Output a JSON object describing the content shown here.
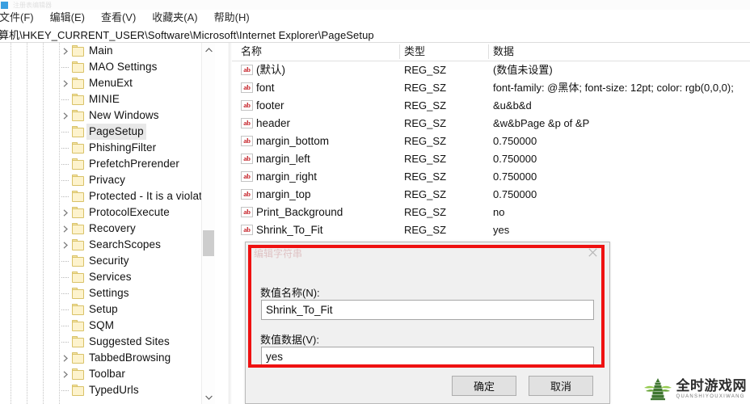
{
  "window": {
    "titlebar_text": "注册表编辑器",
    "titlebar_icon": "registry-editor-icon"
  },
  "menubar": {
    "items": [
      {
        "label": "文件(F)"
      },
      {
        "label": "编辑(E)"
      },
      {
        "label": "查看(V)"
      },
      {
        "label": "收藏夹(A)"
      },
      {
        "label": "帮助(H)"
      }
    ]
  },
  "address": {
    "path": "算机\\HKEY_CURRENT_USER\\Software\\Microsoft\\Internet Explorer\\PageSetup"
  },
  "tree": {
    "items": [
      {
        "label": "Main",
        "expandable": true,
        "selected": false
      },
      {
        "label": "MAO Settings",
        "expandable": false,
        "selected": false
      },
      {
        "label": "MenuExt",
        "expandable": true,
        "selected": false
      },
      {
        "label": "MINIE",
        "expandable": false,
        "selected": false
      },
      {
        "label": "New Windows",
        "expandable": true,
        "selected": false
      },
      {
        "label": "PageSetup",
        "expandable": false,
        "selected": true
      },
      {
        "label": "PhishingFilter",
        "expandable": false,
        "selected": false
      },
      {
        "label": "PrefetchPrerender",
        "expandable": false,
        "selected": false
      },
      {
        "label": "Privacy",
        "expandable": false,
        "selected": false
      },
      {
        "label": "Protected - It is a violation of",
        "expandable": false,
        "selected": false
      },
      {
        "label": "ProtocolExecute",
        "expandable": true,
        "selected": false
      },
      {
        "label": "Recovery",
        "expandable": true,
        "selected": false
      },
      {
        "label": "SearchScopes",
        "expandable": true,
        "selected": false
      },
      {
        "label": "Security",
        "expandable": false,
        "selected": false
      },
      {
        "label": "Services",
        "expandable": false,
        "selected": false
      },
      {
        "label": "Settings",
        "expandable": false,
        "selected": false
      },
      {
        "label": "Setup",
        "expandable": false,
        "selected": false
      },
      {
        "label": "SQM",
        "expandable": false,
        "selected": false
      },
      {
        "label": "Suggested Sites",
        "expandable": false,
        "selected": false
      },
      {
        "label": "TabbedBrowsing",
        "expandable": true,
        "selected": false
      },
      {
        "label": "Toolbar",
        "expandable": true,
        "selected": false
      },
      {
        "label": "TypedUrls",
        "expandable": false,
        "selected": false
      }
    ],
    "scrollbar": {
      "up_icon": "chevron-up-icon",
      "down_icon": "chevron-down-icon"
    }
  },
  "value_list": {
    "columns": [
      {
        "label": "名称"
      },
      {
        "label": "类型"
      },
      {
        "label": "数据"
      }
    ],
    "rows": [
      {
        "icon": "string-value-icon",
        "name": "(默认)",
        "type": "REG_SZ",
        "data": "(数值未设置)"
      },
      {
        "icon": "string-value-icon",
        "name": "font",
        "type": "REG_SZ",
        "data": "font-family: @黑体; font-size: 12pt; color: rgb(0,0,0);"
      },
      {
        "icon": "string-value-icon",
        "name": "footer",
        "type": "REG_SZ",
        "data": "&u&b&d"
      },
      {
        "icon": "string-value-icon",
        "name": "header",
        "type": "REG_SZ",
        "data": "&w&bPage &p of &P"
      },
      {
        "icon": "string-value-icon",
        "name": "margin_bottom",
        "type": "REG_SZ",
        "data": "0.750000"
      },
      {
        "icon": "string-value-icon",
        "name": "margin_left",
        "type": "REG_SZ",
        "data": "0.750000"
      },
      {
        "icon": "string-value-icon",
        "name": "margin_right",
        "type": "REG_SZ",
        "data": "0.750000"
      },
      {
        "icon": "string-value-icon",
        "name": "margin_top",
        "type": "REG_SZ",
        "data": "0.750000"
      },
      {
        "icon": "string-value-icon",
        "name": "Print_Background",
        "type": "REG_SZ",
        "data": "no"
      },
      {
        "icon": "string-value-icon",
        "name": "Shrink_To_Fit",
        "type": "REG_SZ",
        "data": "yes"
      }
    ],
    "icon_text": "ab"
  },
  "dialog": {
    "title": "编辑字符串",
    "close_icon": "close-icon",
    "name_label": "数值名称(N):",
    "name_value": "Shrink_To_Fit",
    "data_label": "数值数据(V):",
    "data_value": "yes",
    "ok_label": "确定",
    "cancel_label": "取消"
  },
  "annotation": {
    "highlight_color": "#ef1111"
  },
  "watermark": {
    "cn": "全时游戏网",
    "en": "QUANSHIYOUXIWANG"
  }
}
